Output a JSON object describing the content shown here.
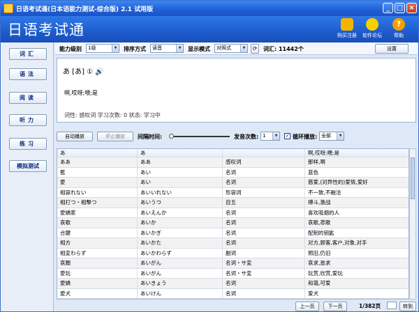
{
  "window": {
    "title": "日语考试通(日本语能力测试-综合版) 2.1 试用版",
    "controls": [
      "_",
      "□",
      "×"
    ]
  },
  "banner": {
    "logo": "日语考试通",
    "toolbar": [
      {
        "label": "购买注册",
        "icon": "cart-icon",
        "color": "#f5b400"
      },
      {
        "label": "软件论坛",
        "icon": "bulb-icon",
        "color": "#f7d000"
      },
      {
        "label": "帮助",
        "icon": "help-icon",
        "color": "#f2a100"
      }
    ]
  },
  "nav": {
    "items": [
      "词汇",
      "语法",
      "阅读",
      "听力",
      "练习",
      "模拟测试"
    ]
  },
  "options": {
    "level_label": "能力级别",
    "level_value": "1级",
    "sort_label": "排序方式",
    "sort_value": "读音",
    "display_label": "显示模式",
    "display_value": "对照式",
    "word_count": "词汇: 11442个",
    "settings_label": "设置"
  },
  "detail": {
    "kana": "あ [あ] ① 🔊",
    "meaning": "啊,哎呀;喂;是",
    "meta": "词性: 感叹词   学习次数: 0   状态: 学习中"
  },
  "playback": {
    "auto_play": "自动播放",
    "stop_play": "停止播放",
    "interval_label": "间隔时间:",
    "repeat_label": "发音次数:",
    "repeat_value": "1",
    "loop_label": "循环播放:",
    "loop_checked": "✓",
    "loop_value": "全部"
  },
  "table": {
    "header": [
      "あ",
      "あ",
      "",
      "啊,哎呀;喂;是"
    ],
    "rows": [
      [
        "ああ",
        "ああ",
        "感叹词",
        "那样,啊"
      ],
      [
        "藍",
        "あい",
        "名词",
        "蓝色"
      ],
      [
        "愛",
        "あい",
        "名词",
        "慈爱,(对异性的)爱情,爱好"
      ],
      [
        "相容れない",
        "あいいれない",
        "形容词",
        "不一致,不融洽"
      ],
      [
        "相打つ・相撃つ",
        "あいうつ",
        "自五",
        "搏斗,激战"
      ],
      [
        "愛嬌家",
        "あいえんか",
        "名词",
        "喜欢吸烟的人"
      ],
      [
        "哀歌",
        "あいか",
        "名词",
        "哀歌,悲歌"
      ],
      [
        "合鍵",
        "あいかぎ",
        "名词",
        "配制的钥匙"
      ],
      [
        "相方",
        "あいかた",
        "名词",
        "对方,顾客,客户,对象,对手"
      ],
      [
        "相変わらず",
        "あいかわらず",
        "副词",
        "照旧,仍旧"
      ],
      [
        "哀願",
        "あいがん",
        "名词・サ変",
        "哀求,恳求"
      ],
      [
        "愛玩",
        "あいがん",
        "名词・サ変",
        "玩赏,欣赏,爱玩"
      ],
      [
        "愛嬌",
        "あいきょう",
        "名词",
        "和蔼,可爱"
      ],
      [
        "愛犬",
        "あいけん",
        "名词",
        "爱犬"
      ]
    ]
  },
  "pager": {
    "prev": "上一页",
    "next": "下一页",
    "info": "1/382页",
    "go": "转到"
  }
}
